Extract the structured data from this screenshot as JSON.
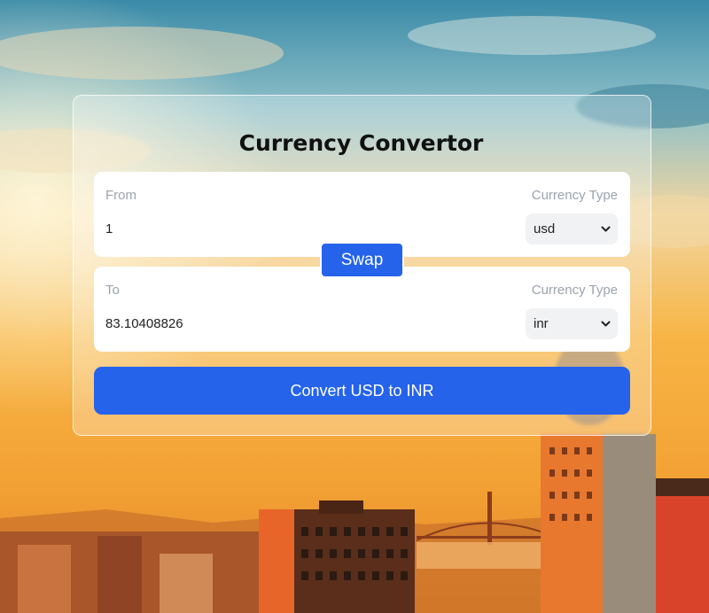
{
  "colors": {
    "accent": "#2563eb",
    "panel_bg": "#ffffff",
    "label_text": "#9ca3af",
    "select_bg": "#f1f2f4"
  },
  "background": {
    "icon": "city-sunset-photo"
  },
  "converter": {
    "title": "Currency Convertor",
    "from": {
      "label": "From",
      "type_label": "Currency Type",
      "amount": "1",
      "currency": "usd"
    },
    "to": {
      "label": "To",
      "type_label": "Currency Type",
      "amount": "83.10408826",
      "currency": "inr"
    },
    "swap_label": "Swap",
    "convert_label": "Convert USD to INR"
  }
}
